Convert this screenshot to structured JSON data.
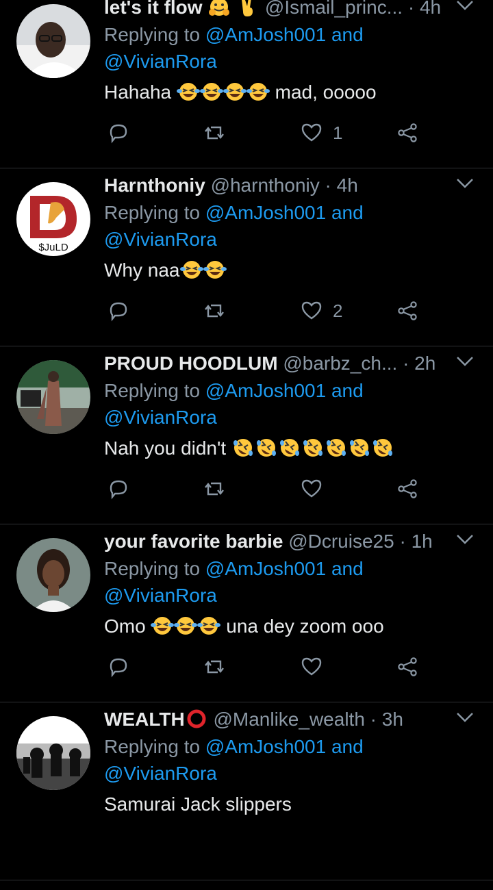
{
  "replying_prefix": "Replying to",
  "tweets": [
    {
      "name": "let's it flow",
      "handle": "@Ismail_princ...",
      "time": "4h",
      "reply_to_1": "@AmJosh001",
      "and_word": "and",
      "reply_to_2": "@VivianRora",
      "text": "Hahaha",
      "text_after": "mad, ooooo",
      "likes": "1",
      "name_emojis": [
        "hugging-face-emoji",
        "victory-hand-emoji"
      ],
      "body_emojis": [
        "laughing-tears-emoji",
        "laughing-tears-emoji",
        "laughing-tears-emoji",
        "laughing-tears-emoji"
      ]
    },
    {
      "name": "Harnthoniy",
      "handle": "@harnthoniy",
      "time": "4h",
      "reply_to_1": "@AmJosh001",
      "and_word": "and",
      "reply_to_2": "@VivianRora",
      "text": "Why naa",
      "text_after": "",
      "likes": "2",
      "avatar_text": "$JuLD",
      "body_emojis": [
        "laughing-tears-emoji",
        "laughing-tears-emoji"
      ]
    },
    {
      "name": "PROUD HOODLUM",
      "handle": "@barbz_ch...",
      "time": "2h",
      "reply_to_1": "@AmJosh001",
      "and_word": "and",
      "reply_to_2": "@VivianRora",
      "text": "Nah you didn't",
      "text_after": "",
      "likes": "",
      "body_emojis": [
        "rolling-laughing-emoji",
        "rolling-laughing-emoji",
        "rolling-laughing-emoji",
        "rolling-laughing-emoji",
        "rolling-laughing-emoji",
        "rolling-laughing-emoji",
        "rolling-laughing-emoji"
      ]
    },
    {
      "name": "your favorite barbie",
      "handle": "@Dcruise25",
      "time": "1h",
      "reply_to_1": "@AmJosh001",
      "and_word": "and",
      "reply_to_2": "@VivianRora",
      "text": "Omo",
      "text_after": "una dey zoom ooo",
      "likes": "",
      "body_emojis": [
        "laughing-tears-emoji",
        "laughing-tears-emoji",
        "laughing-tears-emoji"
      ]
    },
    {
      "name": "WEALTH",
      "handle": "@Manlike_wealth",
      "time": "3h",
      "reply_to_1": "@AmJosh001",
      "and_word": "and",
      "reply_to_2": "@VivianRora",
      "text": "Samurai Jack slippers",
      "text_after": "",
      "likes": "",
      "name_emojis": [
        "red-circle-emoji"
      ]
    }
  ],
  "separator": "·",
  "colors": {
    "background": "#000000",
    "accent": "#1d9bf0",
    "muted": "#8b98a5",
    "text": "#e7e9ea",
    "divider": "#2f3336"
  }
}
